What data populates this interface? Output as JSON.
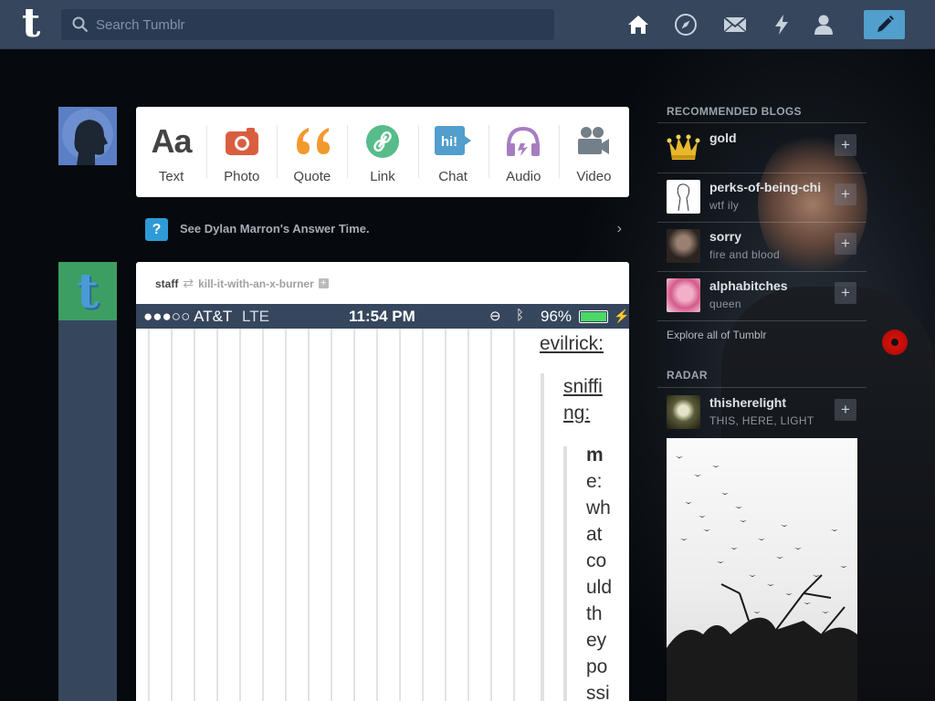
{
  "header": {
    "logo": "t",
    "search_placeholder": "Search Tumblr",
    "nav": [
      "home-icon",
      "explore-icon",
      "messages-icon",
      "activity-icon",
      "account-icon"
    ],
    "compose": "compose-icon"
  },
  "post_types": [
    {
      "label": "Text",
      "glyph": "Aa",
      "color": "#444444"
    },
    {
      "label": "Photo",
      "glyph": "camera",
      "color": "#d95e40"
    },
    {
      "label": "Quote",
      "glyph": "“",
      "color": "#f2992e"
    },
    {
      "label": "Link",
      "glyph": "link",
      "color": "#56bc8a"
    },
    {
      "label": "Chat",
      "glyph": "hi!",
      "color": "#529ecc"
    },
    {
      "label": "Audio",
      "glyph": "headphones",
      "color": "#a77dc2"
    },
    {
      "label": "Video",
      "glyph": "camera",
      "color": "#748089"
    }
  ],
  "answer_time": {
    "text": "See Dylan Marron's Answer Time.",
    "icon": "?"
  },
  "post": {
    "username": "staff",
    "reblog_icon": "reblog-icon",
    "source": "kill-it-with-an-x-burner",
    "follow": "+",
    "phone_status": {
      "carrier": "●●●○○ AT&T",
      "network": "LTE",
      "time": "11:54 PM",
      "battery": "96%"
    },
    "lines": {
      "a": [
        "evilrick:"
      ],
      "b": [
        "sniffi",
        "ng:"
      ],
      "c": [
        "m",
        "e:",
        "wh",
        "at",
        "co",
        "uld",
        "th",
        "ey",
        "po",
        "ssi"
      ]
    }
  },
  "sidebar": {
    "recommended_title": "RECOMMENDED BLOGS",
    "blogs": [
      {
        "name": "gold",
        "tagline": "",
        "follow": "+"
      },
      {
        "name": "perks-of-being-chi",
        "tagline": "wtf ily",
        "follow": "+"
      },
      {
        "name": "sorry",
        "tagline": "fire and blood",
        "follow": "+"
      },
      {
        "name": "alphabitches",
        "tagline": "queen",
        "follow": "+"
      }
    ],
    "explore": "Explore all of Tumblr",
    "radar_title": "RADAR",
    "radar": {
      "name": "thisherelight",
      "tagline": "THIS, HERE, LIGHT",
      "follow": "+"
    }
  },
  "colors": {
    "nav_bg": "#36465d",
    "search_bg": "#2a3a52",
    "compose": "#529ecc",
    "answer_icon": "#2e9ad8"
  }
}
